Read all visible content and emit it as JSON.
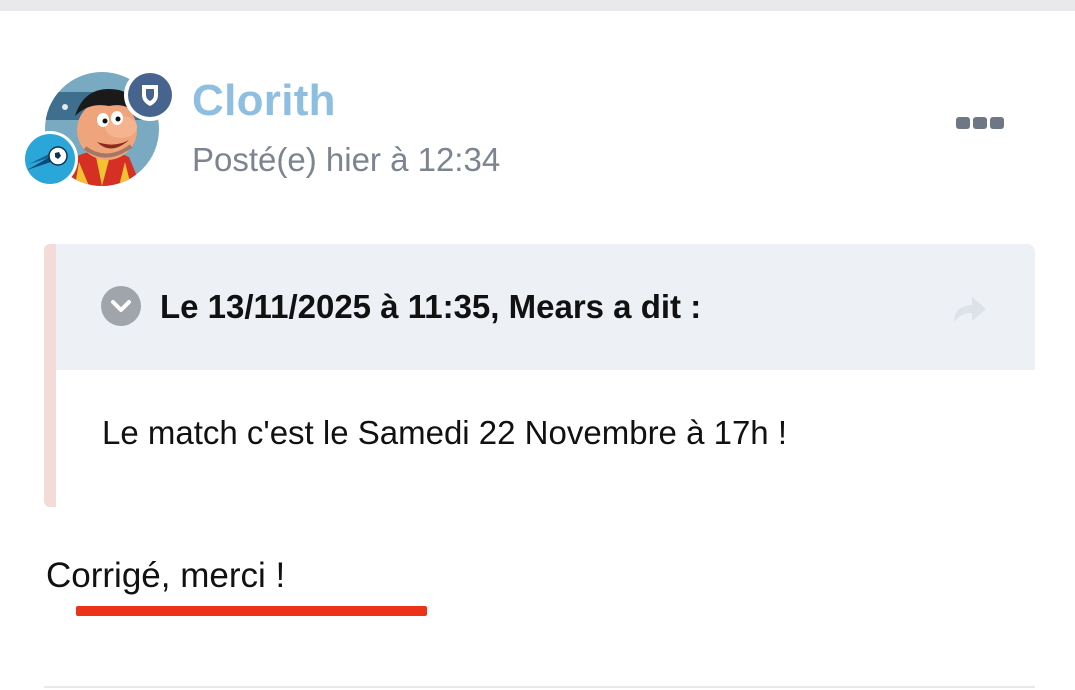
{
  "author": {
    "username": "Clorith",
    "posted": "Posté(e) hier à 12:34",
    "avatar_icon": "cartoon-avatar-icon",
    "moderator_badge_icon": "shield-icon",
    "team_badge_icon": "football-team-icon"
  },
  "menu": {
    "icon": "ellipsis-icon"
  },
  "quote": {
    "attribution": "Le 13/11/2025 à 11:35, Mears a dit :",
    "body": "Le match c'est le Samedi 22 Novembre à 17h !",
    "toggle_icon": "chevron-down-icon",
    "share_icon": "share-arrow-icon"
  },
  "reply": {
    "text": "Corrigé, merci !"
  },
  "colors": {
    "username": "#8fbfe0",
    "moderator_badge": "#46648e",
    "team_badge": "#2ba6d9",
    "quote_border": "#f3dbd8",
    "quote_header": "#edf0f4",
    "underline": "#ea3318"
  }
}
